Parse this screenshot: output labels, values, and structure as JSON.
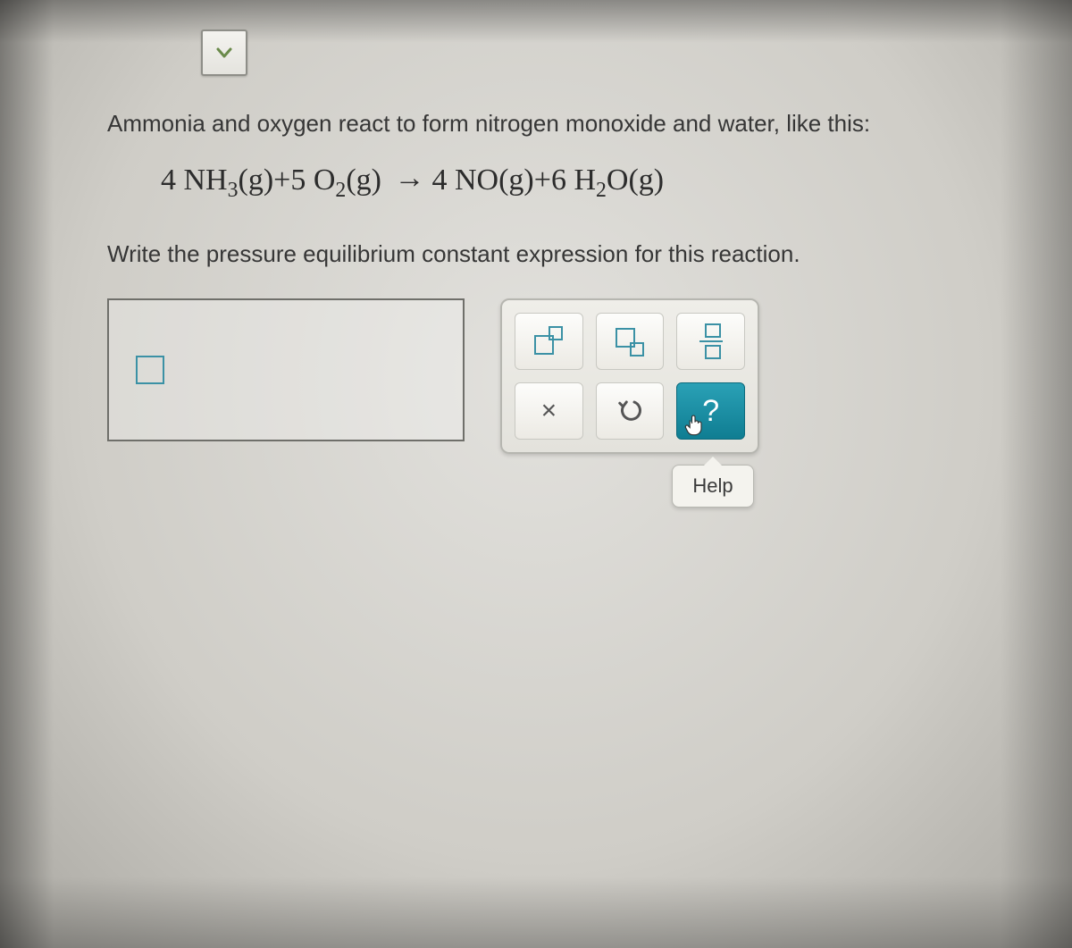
{
  "question": {
    "intro": "Ammonia and oxygen react to form nitrogen monoxide and water, like this:",
    "equation_parts": {
      "c1": "4",
      "r1a": "NH",
      "r1sub": "3",
      "state1": "(g)",
      "plus1": "+",
      "c2": "5",
      "r2a": "O",
      "r2sub": "2",
      "state2": "(g)",
      "arrow": "→",
      "c3": "4",
      "p1a": "NO",
      "state3": "(g)",
      "plus2": "+",
      "c4": "6",
      "p2a": "H",
      "p2sub1": "2",
      "p2b": "O",
      "state4": "(g)"
    },
    "prompt": "Write the pressure equilibrium constant expression for this reaction."
  },
  "tools": {
    "superscript": "superscript",
    "subscript": "subscript",
    "fraction": "fraction",
    "clear": "×",
    "undo": "↶",
    "help": "?",
    "help_tooltip": "Help"
  }
}
